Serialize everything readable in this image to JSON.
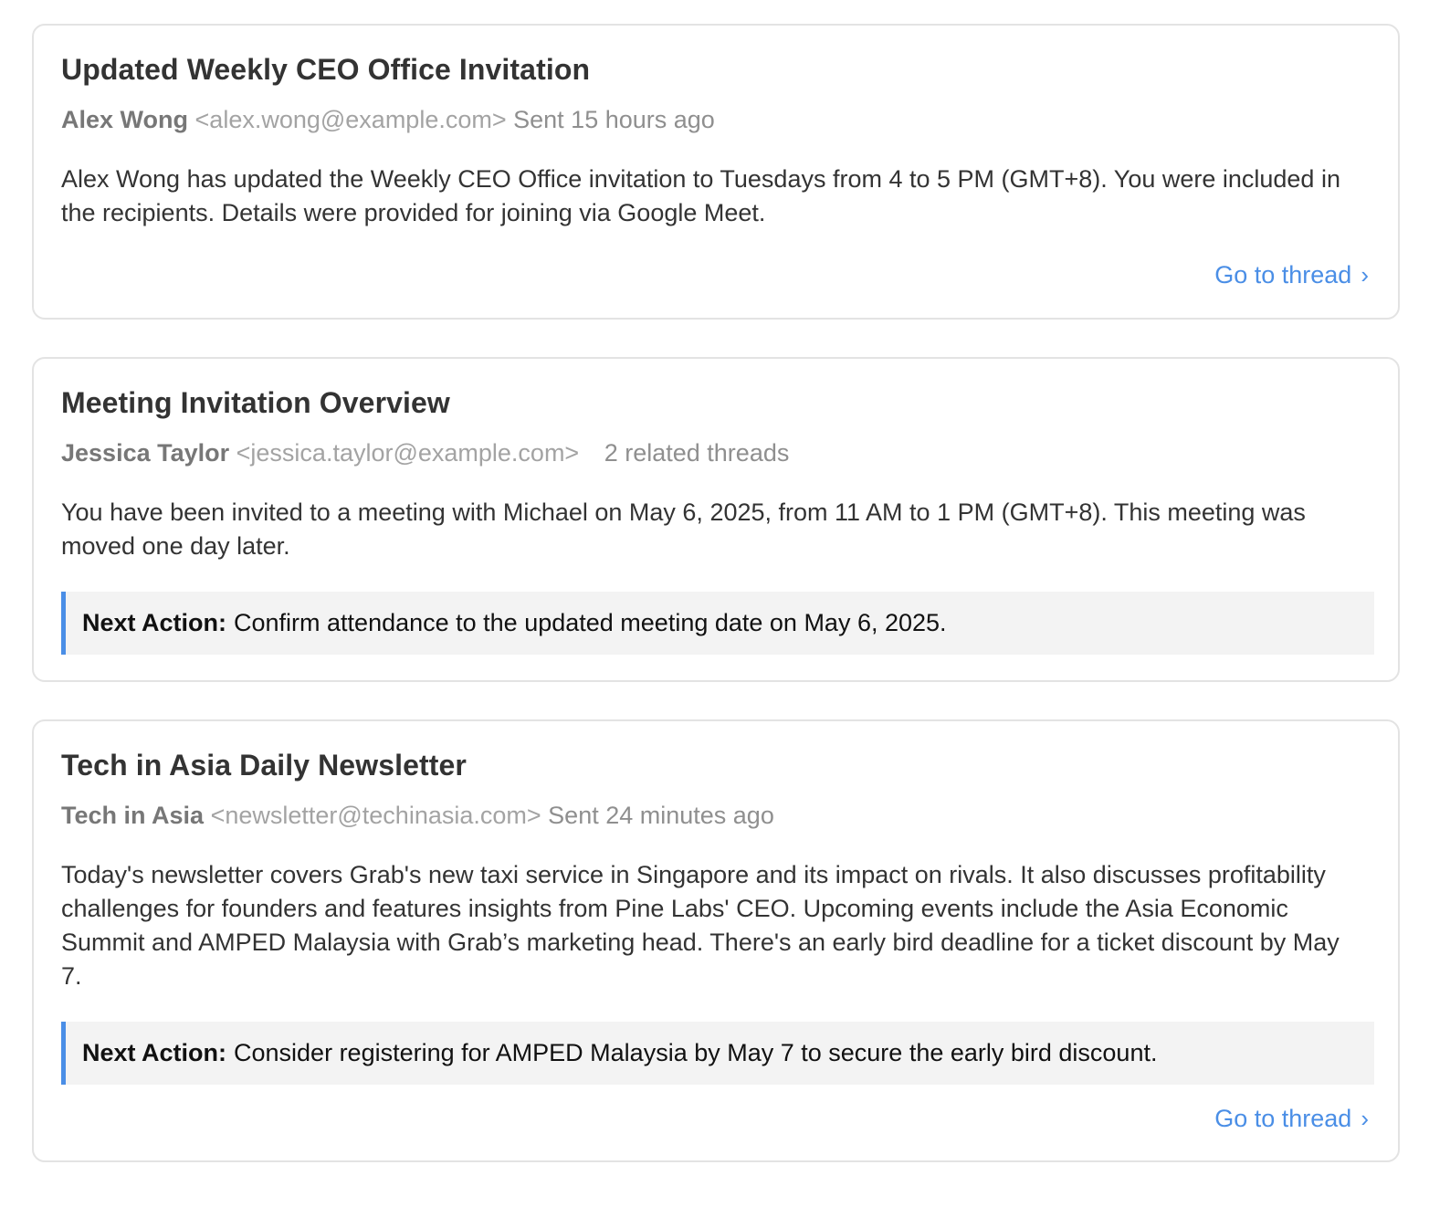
{
  "cards": [
    {
      "title": "Updated Weekly CEO Office Invitation",
      "sender": "Alex Wong",
      "email": "<alex.wong@example.com>",
      "sent": "Sent 15 hours ago",
      "summary": "Alex Wong has updated the Weekly CEO Office invitation to Tuesdays from 4 to 5 PM (GMT+8). You were included in the recipients. Details were provided for joining via Google Meet.",
      "link_label": "Go to thread",
      "chevron": "›"
    },
    {
      "title": "Meeting Invitation Overview",
      "sender": "Jessica Taylor",
      "email": "<jessica.taylor@example.com>",
      "related": "2 related threads",
      "summary": "You have been invited to a meeting with Michael on May 6, 2025, from 11 AM to 1 PM (GMT+8). This meeting was moved one day later.",
      "next_action_label": "Next Action:",
      "next_action": "Confirm attendance to the updated meeting date on May 6, 2025."
    },
    {
      "title": "Tech in Asia Daily Newsletter",
      "sender": "Tech in Asia",
      "email": "<newsletter@techinasia.com>",
      "sent": "Sent 24 minutes ago",
      "summary": "Today's newsletter covers Grab's new taxi service in Singapore and its impact on rivals. It also discusses profitability challenges for founders and features insights from Pine Labs' CEO. Upcoming events include the Asia Economic Summit and AMPED Malaysia with Grab’s marketing head. There's an early bird deadline for a ticket discount by May 7.",
      "next_action_label": "Next Action:",
      "next_action": "Consider registering for AMPED Malaysia by May 7 to secure the early bird discount.",
      "link_label": "Go to thread",
      "chevron": "›"
    }
  ],
  "colors": {
    "accent": "#4a8ee6",
    "border": "#e3e3e3",
    "next_action_bg": "#f3f3f3"
  }
}
